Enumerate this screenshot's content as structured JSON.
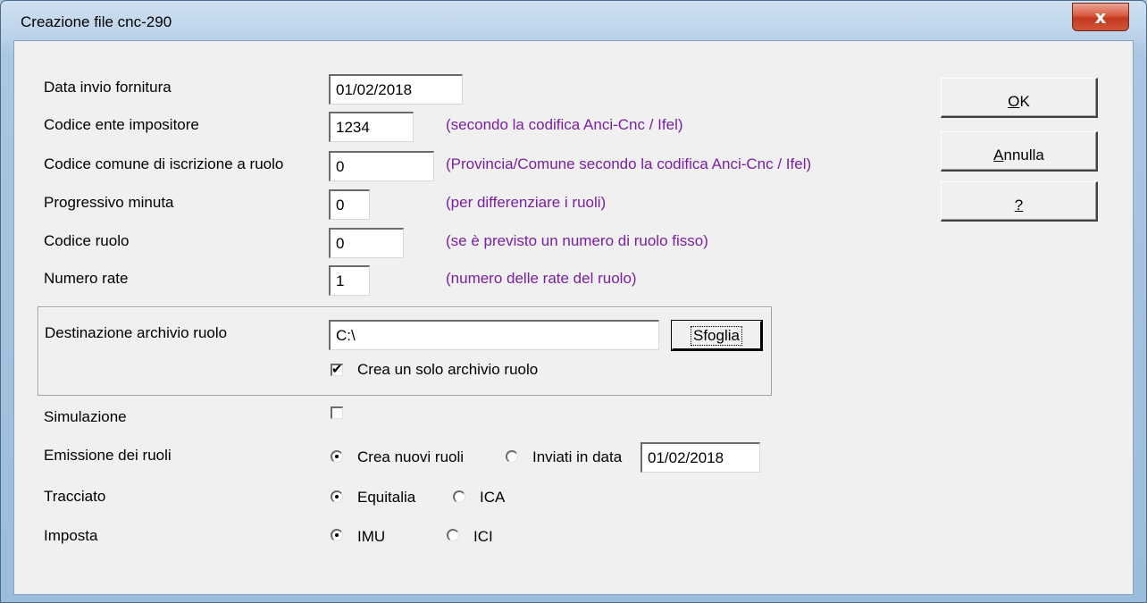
{
  "window": {
    "title": "Creazione file cnc-290",
    "close_glyph": "x"
  },
  "fields": {
    "data_invio": {
      "label": "Data invio fornitura",
      "value": "01/02/2018"
    },
    "codice_ente": {
      "label": "Codice ente impositore",
      "value": "1234",
      "hint": "(secondo la codifica Anci-Cnc / Ifel)"
    },
    "codice_comune": {
      "label": "Codice comune di iscrizione a ruolo",
      "value": "0",
      "hint": "(Provincia/Comune secondo la codifica  Anci-Cnc / Ifel)"
    },
    "progressivo": {
      "label": "Progressivo minuta",
      "value": "0",
      "hint": "(per differenziare i ruoli)"
    },
    "codice_ruolo": {
      "label": "Codice ruolo",
      "value": "0",
      "hint": "(se è previsto un numero di ruolo fisso)"
    },
    "numero_rate": {
      "label": "Numero rate",
      "value": "1",
      "hint": "(numero delle rate del ruolo)"
    }
  },
  "destinazione": {
    "label": "Destinazione archivio ruolo",
    "path": "C:\\",
    "browse_button": "Sfoglia",
    "single_archive_label": "Crea un solo archivio ruolo",
    "single_archive_checked": true
  },
  "simulazione": {
    "label": "Simulazione",
    "checked": false
  },
  "emissione": {
    "label": "Emissione dei ruoli",
    "options": [
      "Crea nuovi ruoli",
      "Inviati in data"
    ],
    "selected": "Crea nuovi ruoli",
    "date_value": "01/02/2018"
  },
  "tracciato": {
    "label": "Tracciato",
    "options": [
      "Equitalia",
      "ICA"
    ],
    "selected": "Equitalia"
  },
  "imposta": {
    "label": "Imposta",
    "options": [
      "IMU",
      "ICI"
    ],
    "selected": "IMU"
  },
  "buttons": {
    "ok": {
      "mnemonic": "O",
      "rest": "K"
    },
    "annulla": {
      "mnemonic": "A",
      "rest": "nnulla"
    },
    "help": {
      "mnemonic": "?",
      "rest": ""
    }
  },
  "colors": {
    "hint_text": "#7a1fa0",
    "titlebar": "#bcd3ea",
    "close_button": "#c4391d",
    "dialog_bg": "#f0f0f0"
  },
  "icons": {
    "close": "close-icon",
    "checkmark": "checkmark-icon",
    "radio_dot": "radio-dot-icon"
  }
}
